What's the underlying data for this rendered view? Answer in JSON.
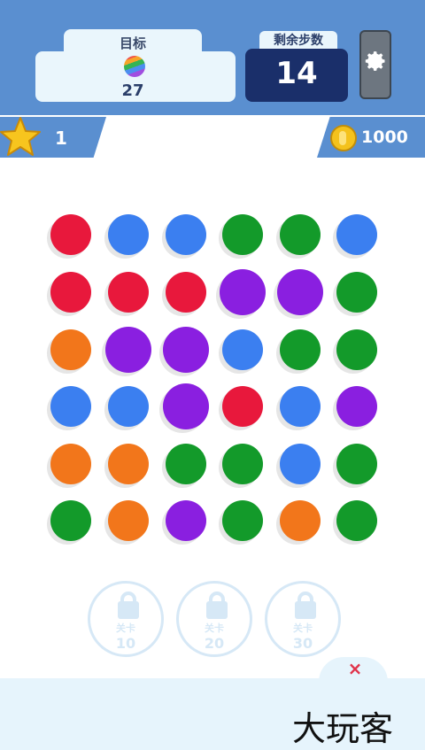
{
  "goal": {
    "title": "目标",
    "count": "27"
  },
  "moves": {
    "label": "剩余步数",
    "value": "14"
  },
  "stars": {
    "count": "1"
  },
  "coins": {
    "count": "1000"
  },
  "colors": {
    "red": "#e8183c",
    "blue": "#3b7ff0",
    "green": "#139a2a",
    "purple": "#8a1fe0",
    "orange": "#f2761b"
  },
  "board": {
    "rows": [
      [
        "red",
        "blue",
        "blue",
        "green",
        "green",
        "blue"
      ],
      [
        "red",
        "red",
        "red",
        "purple",
        "purple",
        "green"
      ],
      [
        "orange",
        "purple",
        "purple",
        "blue",
        "green",
        "green"
      ],
      [
        "blue",
        "blue",
        "purple",
        "red",
        "blue",
        "purple"
      ],
      [
        "orange",
        "orange",
        "green",
        "green",
        "blue",
        "green"
      ],
      [
        "green",
        "orange",
        "purple",
        "green",
        "orange",
        "green"
      ]
    ]
  },
  "locked_levels": [
    {
      "label": "关卡",
      "level": "10"
    },
    {
      "label": "关卡",
      "level": "20"
    },
    {
      "label": "关卡",
      "level": "30"
    }
  ],
  "close_label": "×",
  "watermark": "大玩客"
}
